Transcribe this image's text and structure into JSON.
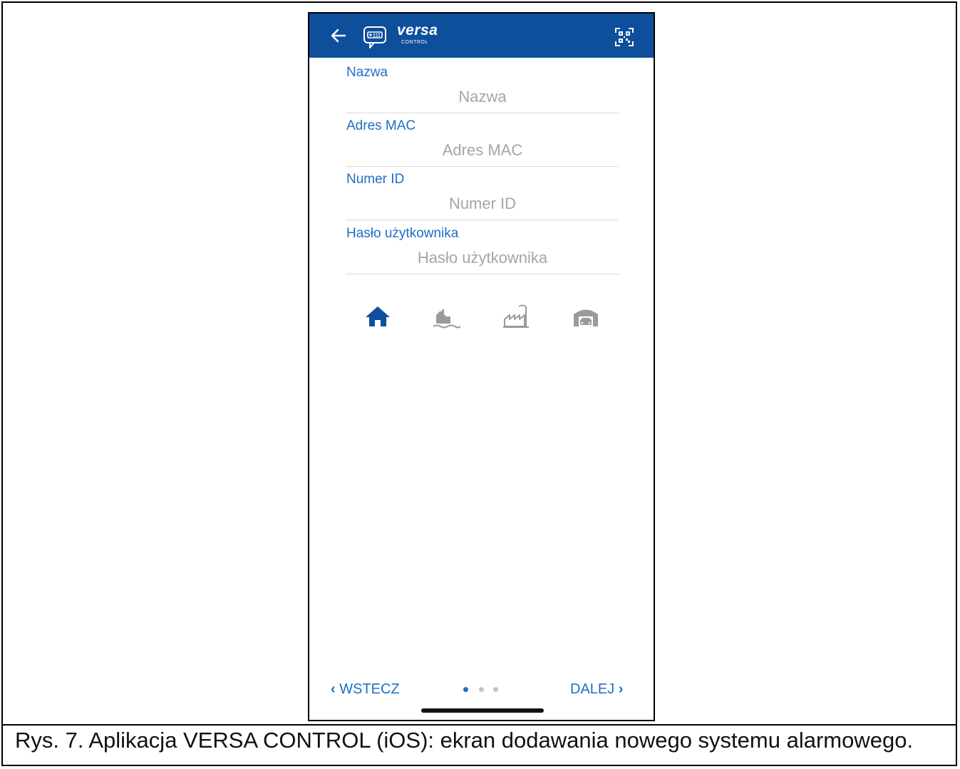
{
  "app": {
    "brand_name": "versa",
    "brand_sub": "CONTROL"
  },
  "fields": [
    {
      "label": "Nazwa",
      "placeholder": "Nazwa",
      "value": ""
    },
    {
      "label": "Adres MAC",
      "placeholder": "Adres MAC",
      "value": ""
    },
    {
      "label": "Numer ID",
      "placeholder": "Numer ID",
      "value": ""
    },
    {
      "label": "Hasło użytkownika",
      "placeholder": "Hasło użytkownika",
      "value": ""
    }
  ],
  "system_types": [
    {
      "icon": "house-icon",
      "selected": true
    },
    {
      "icon": "waterfront-house-icon",
      "selected": false
    },
    {
      "icon": "factory-icon",
      "selected": false
    },
    {
      "icon": "garage-icon",
      "selected": false
    }
  ],
  "footer": {
    "back_label": "WSTECZ",
    "next_label": "DALEJ",
    "page_count": 3,
    "current_page": 1
  },
  "caption": "Rys. 7. Aplikacja VERSA CONTROL (iOS): ekran dodawania nowego systemu alarmowego.",
  "colors": {
    "appbar": "#0e4f9c",
    "accent": "#1e6fc6",
    "icon_selected": "#0e4f9c",
    "icon_inactive": "#9a9a9a"
  }
}
